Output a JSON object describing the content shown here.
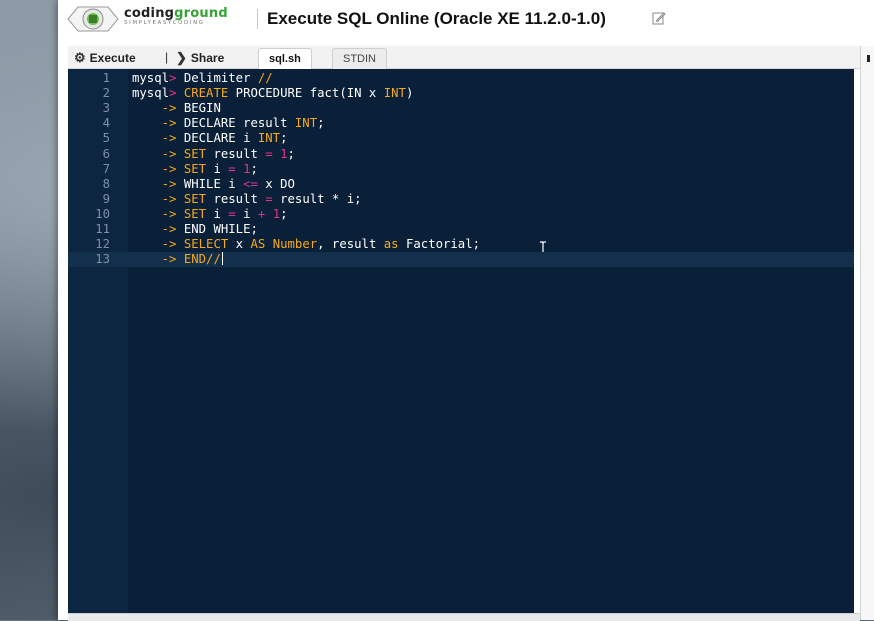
{
  "header": {
    "brand_coding": "coding",
    "brand_ground": "ground",
    "brand_tagline": "SIMPLYEASYCODING",
    "title": "Execute SQL Online (Oracle XE 11.2.0-1.0)",
    "icons": {
      "logo": "codingground-logo-icon",
      "edit": "edit-icon"
    }
  },
  "toolbar": {
    "execute_label": "Execute",
    "separator": "|",
    "share_label": "Share",
    "tabs": [
      {
        "label": "sql.sh",
        "active": true
      },
      {
        "label": "STDIN",
        "active": false
      }
    ],
    "icons": {
      "execute": "gears-icon",
      "share": "chevron-right-icon"
    }
  },
  "editor": {
    "colors": {
      "background": "#0a2038",
      "keyword": "#f7a81b",
      "operator": "#e0348a",
      "text": "#ffffff"
    },
    "active_line": 13,
    "lines": [
      {
        "n": "1",
        "t": [
          [
            "mysql",
            ""
          ],
          [
            ">",
            "op"
          ],
          [
            " Delimiter ",
            ""
          ],
          [
            "//",
            "com"
          ]
        ]
      },
      {
        "n": "2",
        "t": [
          [
            "mysql",
            ""
          ],
          [
            ">",
            "op"
          ],
          [
            " ",
            ""
          ],
          [
            "CREATE",
            "kw"
          ],
          [
            " PROCEDURE fact(IN x ",
            ""
          ],
          [
            "INT",
            "kw"
          ],
          [
            ")",
            ""
          ]
        ]
      },
      {
        "n": "3",
        "t": [
          [
            "    ",
            ""
          ],
          [
            "->",
            "kw"
          ],
          [
            " BEGIN",
            ""
          ]
        ]
      },
      {
        "n": "4",
        "t": [
          [
            "    ",
            ""
          ],
          [
            "->",
            "kw"
          ],
          [
            " DECLARE result ",
            ""
          ],
          [
            "INT",
            "kw"
          ],
          [
            ";",
            ""
          ]
        ]
      },
      {
        "n": "5",
        "t": [
          [
            "    ",
            ""
          ],
          [
            "->",
            "kw"
          ],
          [
            " DECLARE i ",
            ""
          ],
          [
            "INT",
            "kw"
          ],
          [
            ";",
            ""
          ]
        ]
      },
      {
        "n": "6",
        "t": [
          [
            "    ",
            ""
          ],
          [
            "->",
            "kw"
          ],
          [
            " ",
            ""
          ],
          [
            "SET",
            "kw"
          ],
          [
            " result ",
            ""
          ],
          [
            "=",
            "op"
          ],
          [
            " ",
            ""
          ],
          [
            "1",
            "num"
          ],
          [
            ";",
            ""
          ]
        ]
      },
      {
        "n": "7",
        "t": [
          [
            "    ",
            ""
          ],
          [
            "->",
            "kw"
          ],
          [
            " ",
            ""
          ],
          [
            "SET",
            "kw"
          ],
          [
            " i ",
            ""
          ],
          [
            "=",
            "op"
          ],
          [
            " ",
            ""
          ],
          [
            "1",
            "num"
          ],
          [
            ";",
            ""
          ]
        ]
      },
      {
        "n": "8",
        "t": [
          [
            "    ",
            ""
          ],
          [
            "->",
            "kw"
          ],
          [
            " WHILE i ",
            ""
          ],
          [
            "<=",
            "op"
          ],
          [
            " x DO",
            ""
          ]
        ]
      },
      {
        "n": "9",
        "t": [
          [
            "    ",
            ""
          ],
          [
            "->",
            "kw"
          ],
          [
            " ",
            ""
          ],
          [
            "SET",
            "kw"
          ],
          [
            " result ",
            ""
          ],
          [
            "=",
            "op"
          ],
          [
            " result * i;",
            ""
          ]
        ]
      },
      {
        "n": "10",
        "t": [
          [
            "    ",
            ""
          ],
          [
            "->",
            "kw"
          ],
          [
            " ",
            ""
          ],
          [
            "SET",
            "kw"
          ],
          [
            " i ",
            ""
          ],
          [
            "=",
            "op"
          ],
          [
            " i ",
            ""
          ],
          [
            "+",
            "op"
          ],
          [
            " ",
            ""
          ],
          [
            "1",
            "num"
          ],
          [
            ";",
            ""
          ]
        ]
      },
      {
        "n": "11",
        "t": [
          [
            "    ",
            ""
          ],
          [
            "->",
            "kw"
          ],
          [
            " END WHILE;",
            ""
          ]
        ]
      },
      {
        "n": "12",
        "t": [
          [
            "    ",
            ""
          ],
          [
            "->",
            "kw"
          ],
          [
            " ",
            ""
          ],
          [
            "SELECT",
            "kw"
          ],
          [
            " x ",
            ""
          ],
          [
            "AS",
            "kw"
          ],
          [
            " ",
            ""
          ],
          [
            "Number",
            "kw"
          ],
          [
            ", result ",
            ""
          ],
          [
            "as",
            "kw"
          ],
          [
            " Factorial;",
            ""
          ]
        ]
      },
      {
        "n": "13",
        "t": [
          [
            "    ",
            ""
          ],
          [
            "->",
            "kw"
          ],
          [
            " ",
            ""
          ],
          [
            "END//",
            "kw"
          ]
        ]
      }
    ]
  }
}
